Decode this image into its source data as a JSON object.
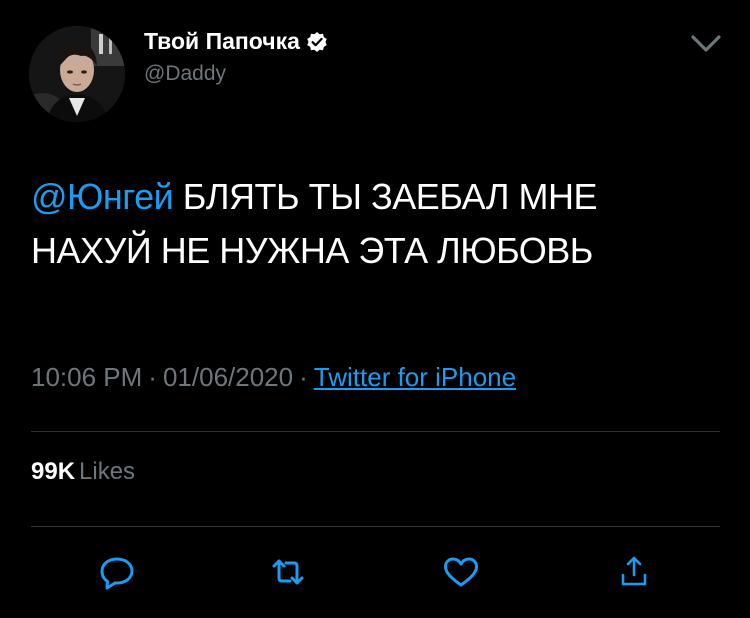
{
  "tweet": {
    "author": {
      "display_name": "Твой Папочка",
      "handle": "@Daddy",
      "verified": true
    },
    "text": {
      "mention": "@Юнгей",
      "body": " БЛЯТЬ ТЫ ЗАЕБАЛ МНЕ НАХУЙ НЕ НУЖНА ЭТА ЛЮБОВЬ"
    },
    "meta": {
      "time": "10:06 PM",
      "separator": "·",
      "date": "01/06/2020",
      "source": "Twitter for iPhone"
    },
    "stats": {
      "likes_count": "99K",
      "likes_label": "Likes"
    }
  },
  "icons": {
    "menu": "chevron-down-icon",
    "verified": "verified-badge-icon",
    "reply": "reply-icon",
    "retweet": "retweet-icon",
    "like": "heart-icon",
    "share": "share-icon"
  },
  "colors": {
    "background": "#000000",
    "text": "#ffffff",
    "secondary": "#6e767d",
    "accent": "#1d9bf0",
    "divider": "#2f3336"
  }
}
